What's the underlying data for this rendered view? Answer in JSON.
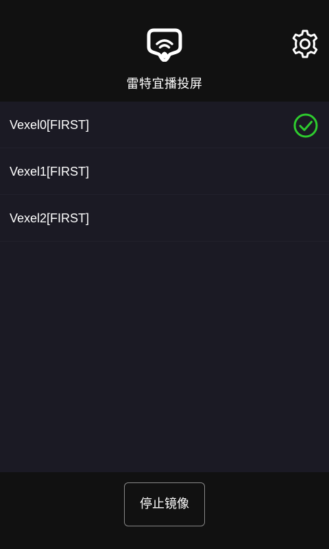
{
  "header": {
    "title": "雷特宜播投屏",
    "logo_icon": "cast-screen-logo-icon",
    "settings_icon": "gear-icon"
  },
  "devices": [
    {
      "label": "Vexel0[FIRST]",
      "selected": true
    },
    {
      "label": "Vexel1[FIRST]",
      "selected": false
    },
    {
      "label": "Vexel2[FIRST]",
      "selected": false
    }
  ],
  "footer": {
    "stop_label": "停止镜像"
  },
  "colors": {
    "background": "#111111",
    "list_background": "#1b1a24",
    "check_green": "#2ecc2e",
    "button_border": "#8a8a8a"
  }
}
